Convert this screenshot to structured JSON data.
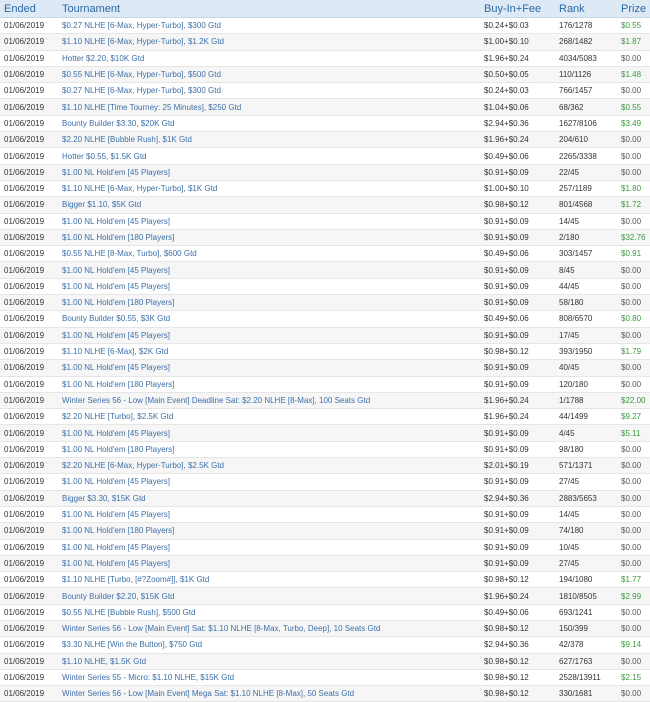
{
  "columns": {
    "ended": "Ended",
    "tournament": "Tournament",
    "buyin": "Buy-In+Fee",
    "rank": "Rank",
    "prize": "Prize"
  },
  "rows": [
    {
      "ended": "01/06/2019",
      "tournament": "$0.27 NLHE [6-Max, Hyper-Turbo], $300 Gtd",
      "buyin": "$0.24+$0.03",
      "rank": "176/1278",
      "prize": "$0.55"
    },
    {
      "ended": "01/06/2019",
      "tournament": "$1.10 NLHE [6-Max, Hyper-Turbo], $1.2K Gtd",
      "buyin": "$1.00+$0.10",
      "rank": "268/1482",
      "prize": "$1.87"
    },
    {
      "ended": "01/06/2019",
      "tournament": "Hotter $2.20, $10K Gtd",
      "buyin": "$1.96+$0.24",
      "rank": "4034/5083",
      "prize": "$0.00"
    },
    {
      "ended": "01/06/2019",
      "tournament": "$0.55 NLHE [6-Max, Hyper-Turbo], $500 Gtd",
      "buyin": "$0.50+$0.05",
      "rank": "110/1126",
      "prize": "$1.48"
    },
    {
      "ended": "01/06/2019",
      "tournament": "$0.27 NLHE [6-Max, Hyper-Turbo], $300 Gtd",
      "buyin": "$0.24+$0.03",
      "rank": "766/1457",
      "prize": "$0.00"
    },
    {
      "ended": "01/06/2019",
      "tournament": "$1.10 NLHE [Time Tourney: 25 Minutes], $250 Gtd",
      "buyin": "$1.04+$0.06",
      "rank": "68/362",
      "prize": "$0.55"
    },
    {
      "ended": "01/06/2019",
      "tournament": "Bounty Builder $3.30, $20K Gtd",
      "buyin": "$2.94+$0.36",
      "rank": "1627/8106",
      "prize": "$3.49"
    },
    {
      "ended": "01/06/2019",
      "tournament": "$2.20 NLHE [Bubble Rush], $1K Gtd",
      "buyin": "$1.96+$0.24",
      "rank": "204/610",
      "prize": "$0.00"
    },
    {
      "ended": "01/06/2019",
      "tournament": "Hotter $0.55, $1.5K Gtd",
      "buyin": "$0.49+$0.06",
      "rank": "2265/3338",
      "prize": "$0.00"
    },
    {
      "ended": "01/06/2019",
      "tournament": "$1.00 NL Hold'em [45 Players]",
      "buyin": "$0.91+$0.09",
      "rank": "22/45",
      "prize": "$0.00"
    },
    {
      "ended": "01/06/2019",
      "tournament": "$1.10 NLHE [6-Max, Hyper-Turbo], $1K Gtd",
      "buyin": "$1.00+$0.10",
      "rank": "257/1189",
      "prize": "$1.80"
    },
    {
      "ended": "01/06/2019",
      "tournament": "Bigger $1.10, $5K Gtd",
      "buyin": "$0.98+$0.12",
      "rank": "801/4568",
      "prize": "$1.72"
    },
    {
      "ended": "01/06/2019",
      "tournament": "$1.00 NL Hold'em [45 Players]",
      "buyin": "$0.91+$0.09",
      "rank": "14/45",
      "prize": "$0.00"
    },
    {
      "ended": "01/06/2019",
      "tournament": "$1.00 NL Hold'em [180 Players]",
      "buyin": "$0.91+$0.09",
      "rank": "2/180",
      "prize": "$32.76"
    },
    {
      "ended": "01/06/2019",
      "tournament": "$0.55 NLHE [8-Max, Turbo], $600 Gtd",
      "buyin": "$0.49+$0.06",
      "rank": "303/1457",
      "prize": "$0.91"
    },
    {
      "ended": "01/06/2019",
      "tournament": "$1.00 NL Hold'em [45 Players]",
      "buyin": "$0.91+$0.09",
      "rank": "8/45",
      "prize": "$0.00"
    },
    {
      "ended": "01/06/2019",
      "tournament": "$1.00 NL Hold'em [45 Players]",
      "buyin": "$0.91+$0.09",
      "rank": "44/45",
      "prize": "$0.00"
    },
    {
      "ended": "01/06/2019",
      "tournament": "$1.00 NL Hold'em [180 Players]",
      "buyin": "$0.91+$0.09",
      "rank": "58/180",
      "prize": "$0.00"
    },
    {
      "ended": "01/06/2019",
      "tournament": "Bounty Builder $0.55, $3K Gtd",
      "buyin": "$0.49+$0.06",
      "rank": "808/6570",
      "prize": "$0.80"
    },
    {
      "ended": "01/06/2019",
      "tournament": "$1.00 NL Hold'em [45 Players]",
      "buyin": "$0.91+$0.09",
      "rank": "17/45",
      "prize": "$0.00"
    },
    {
      "ended": "01/06/2019",
      "tournament": "$1.10 NLHE [6-Max], $2K Gtd",
      "buyin": "$0.98+$0.12",
      "rank": "393/1950",
      "prize": "$1.79"
    },
    {
      "ended": "01/06/2019",
      "tournament": "$1.00 NL Hold'em [45 Players]",
      "buyin": "$0.91+$0.09",
      "rank": "40/45",
      "prize": "$0.00"
    },
    {
      "ended": "01/06/2019",
      "tournament": "$1.00 NL Hold'em [180 Players]",
      "buyin": "$0.91+$0.09",
      "rank": "120/180",
      "prize": "$0.00"
    },
    {
      "ended": "01/06/2019",
      "tournament": "Winter Series 56 - Low [Main Event] Deadline Sat: $2.20 NLHE [8-Max], 100 Seats Gtd",
      "buyin": "$1.96+$0.24",
      "rank": "1/1788",
      "prize": "$22.00"
    },
    {
      "ended": "01/06/2019",
      "tournament": "$2.20 NLHE [Turbo], $2.5K Gtd",
      "buyin": "$1.96+$0.24",
      "rank": "44/1499",
      "prize": "$9.27"
    },
    {
      "ended": "01/06/2019",
      "tournament": "$1.00 NL Hold'em [45 Players]",
      "buyin": "$0.91+$0.09",
      "rank": "4/45",
      "prize": "$5.11"
    },
    {
      "ended": "01/06/2019",
      "tournament": "$1.00 NL Hold'em [180 Players]",
      "buyin": "$0.91+$0.09",
      "rank": "98/180",
      "prize": "$0.00"
    },
    {
      "ended": "01/06/2019",
      "tournament": "$2.20 NLHE [6-Max, Hyper-Turbo], $2.5K Gtd",
      "buyin": "$2.01+$0.19",
      "rank": "571/1371",
      "prize": "$0.00"
    },
    {
      "ended": "01/06/2019",
      "tournament": "$1.00 NL Hold'em [45 Players]",
      "buyin": "$0.91+$0.09",
      "rank": "27/45",
      "prize": "$0.00"
    },
    {
      "ended": "01/06/2019",
      "tournament": "Bigger $3.30, $15K Gtd",
      "buyin": "$2.94+$0.36",
      "rank": "2883/5653",
      "prize": "$0.00"
    },
    {
      "ended": "01/06/2019",
      "tournament": "$1.00 NL Hold'em [45 Players]",
      "buyin": "$0.91+$0.09",
      "rank": "14/45",
      "prize": "$0.00"
    },
    {
      "ended": "01/06/2019",
      "tournament": "$1.00 NL Hold'em [180 Players]",
      "buyin": "$0.91+$0.09",
      "rank": "74/180",
      "prize": "$0.00"
    },
    {
      "ended": "01/06/2019",
      "tournament": "$1.00 NL Hold'em [45 Players]",
      "buyin": "$0.91+$0.09",
      "rank": "10/45",
      "prize": "$0.00"
    },
    {
      "ended": "01/06/2019",
      "tournament": "$1.00 NL Hold'em [45 Players]",
      "buyin": "$0.91+$0.09",
      "rank": "27/45",
      "prize": "$0.00"
    },
    {
      "ended": "01/06/2019",
      "tournament": "$1.10 NLHE [Turbo, [#?Zoom#]], $1K Gtd",
      "buyin": "$0.98+$0.12",
      "rank": "194/1080",
      "prize": "$1.77"
    },
    {
      "ended": "01/06/2019",
      "tournament": "Bounty Builder $2.20, $15K Gtd",
      "buyin": "$1.96+$0.24",
      "rank": "1810/8505",
      "prize": "$2.99"
    },
    {
      "ended": "01/06/2019",
      "tournament": "$0.55 NLHE [Bubble Rush], $500 Gtd",
      "buyin": "$0.49+$0.06",
      "rank": "693/1241",
      "prize": "$0.00"
    },
    {
      "ended": "01/06/2019",
      "tournament": "Winter Series 56 - Low [Main Event] Sat: $1.10 NLHE [8-Max, Turbo, Deep], 10 Seats Gtd",
      "buyin": "$0.98+$0.12",
      "rank": "150/399",
      "prize": "$0.00"
    },
    {
      "ended": "01/06/2019",
      "tournament": "$3.30 NLHE [Win the Button], $750 Gtd",
      "buyin": "$2.94+$0.36",
      "rank": "42/378",
      "prize": "$9.14"
    },
    {
      "ended": "01/06/2019",
      "tournament": "$1.10 NLHE, $1.5K Gtd",
      "buyin": "$0.98+$0.12",
      "rank": "627/1763",
      "prize": "$0.00"
    },
    {
      "ended": "01/06/2019",
      "tournament": "Winter Series 55 - Micro: $1.10 NLHE, $15K Gtd",
      "buyin": "$0.98+$0.12",
      "rank": "2528/13911",
      "prize": "$2.15"
    },
    {
      "ended": "01/06/2019",
      "tournament": "Winter Series 56 - Low [Main Event] Mega Sat: $1.10 NLHE [8-Max], 50 Seats Gtd",
      "buyin": "$0.98+$0.12",
      "rank": "330/1681",
      "prize": "$0.00"
    }
  ]
}
